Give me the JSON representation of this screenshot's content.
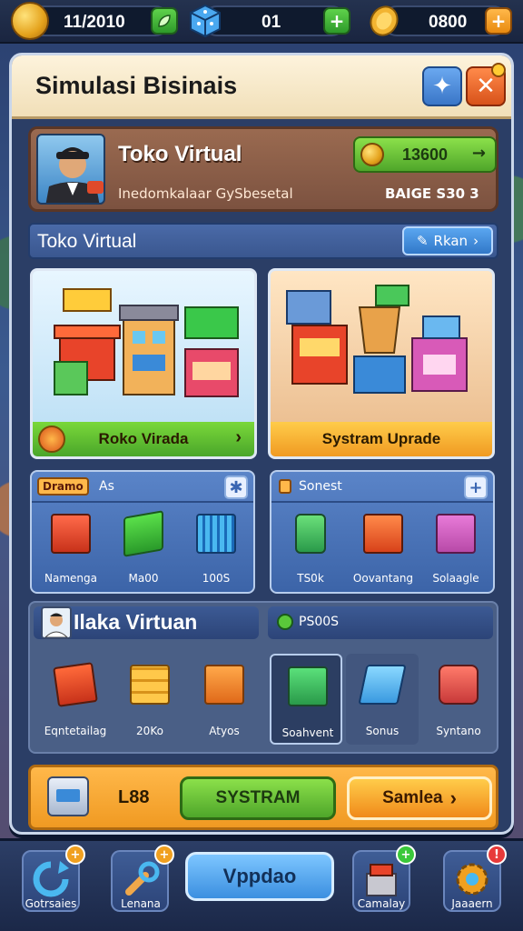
{
  "topbar": {
    "coins": "11/2010",
    "gems": "01",
    "gold": "0800"
  },
  "panel": {
    "title": "Simulasi Bisinais"
  },
  "profile": {
    "name": "Toko Virtual",
    "subtitle": "Inedomkalaar GySbesetal",
    "coin_value": "13600",
    "stat": "BAIGE S30 3"
  },
  "section": {
    "title": "Toko Virtual",
    "button_label": "Rkan"
  },
  "cards": [
    {
      "label": "Roko Virada"
    },
    {
      "label": "Systram Uprade"
    }
  ],
  "item_panels": [
    {
      "badge": "Dramo",
      "title": "As",
      "items": [
        {
          "label": "Namenga"
        },
        {
          "label": "Ma00"
        },
        {
          "label": "100S"
        }
      ]
    },
    {
      "title": "Sonest",
      "items": [
        {
          "label": "TS0k"
        },
        {
          "label": "Oovantang"
        },
        {
          "label": "Solaagle"
        }
      ]
    }
  ],
  "market": {
    "title": "Ilaka Virtuan",
    "badge": "PS00S",
    "items": [
      {
        "label": "Eqntetailag"
      },
      {
        "label": "20Ko"
      },
      {
        "label": "Atyos"
      },
      {
        "label": "Soahvent"
      },
      {
        "label": "Sonus"
      },
      {
        "label": "Syntano"
      }
    ]
  },
  "action": {
    "value": "L88",
    "primary_label": "SYSTRAM",
    "secondary_label": "Samlea"
  },
  "bottom_nav": {
    "items": [
      {
        "label": "Gotrsaies"
      },
      {
        "label": "Lenana"
      },
      {
        "label": "Camalay"
      },
      {
        "label": "Jaaaern"
      }
    ],
    "center_label": "Vppdao"
  },
  "colors": {
    "accent_green": "#6bc43a",
    "accent_orange": "#f5a020",
    "accent_blue": "#3b8fe0",
    "panel_bg": "#2b3e66"
  }
}
